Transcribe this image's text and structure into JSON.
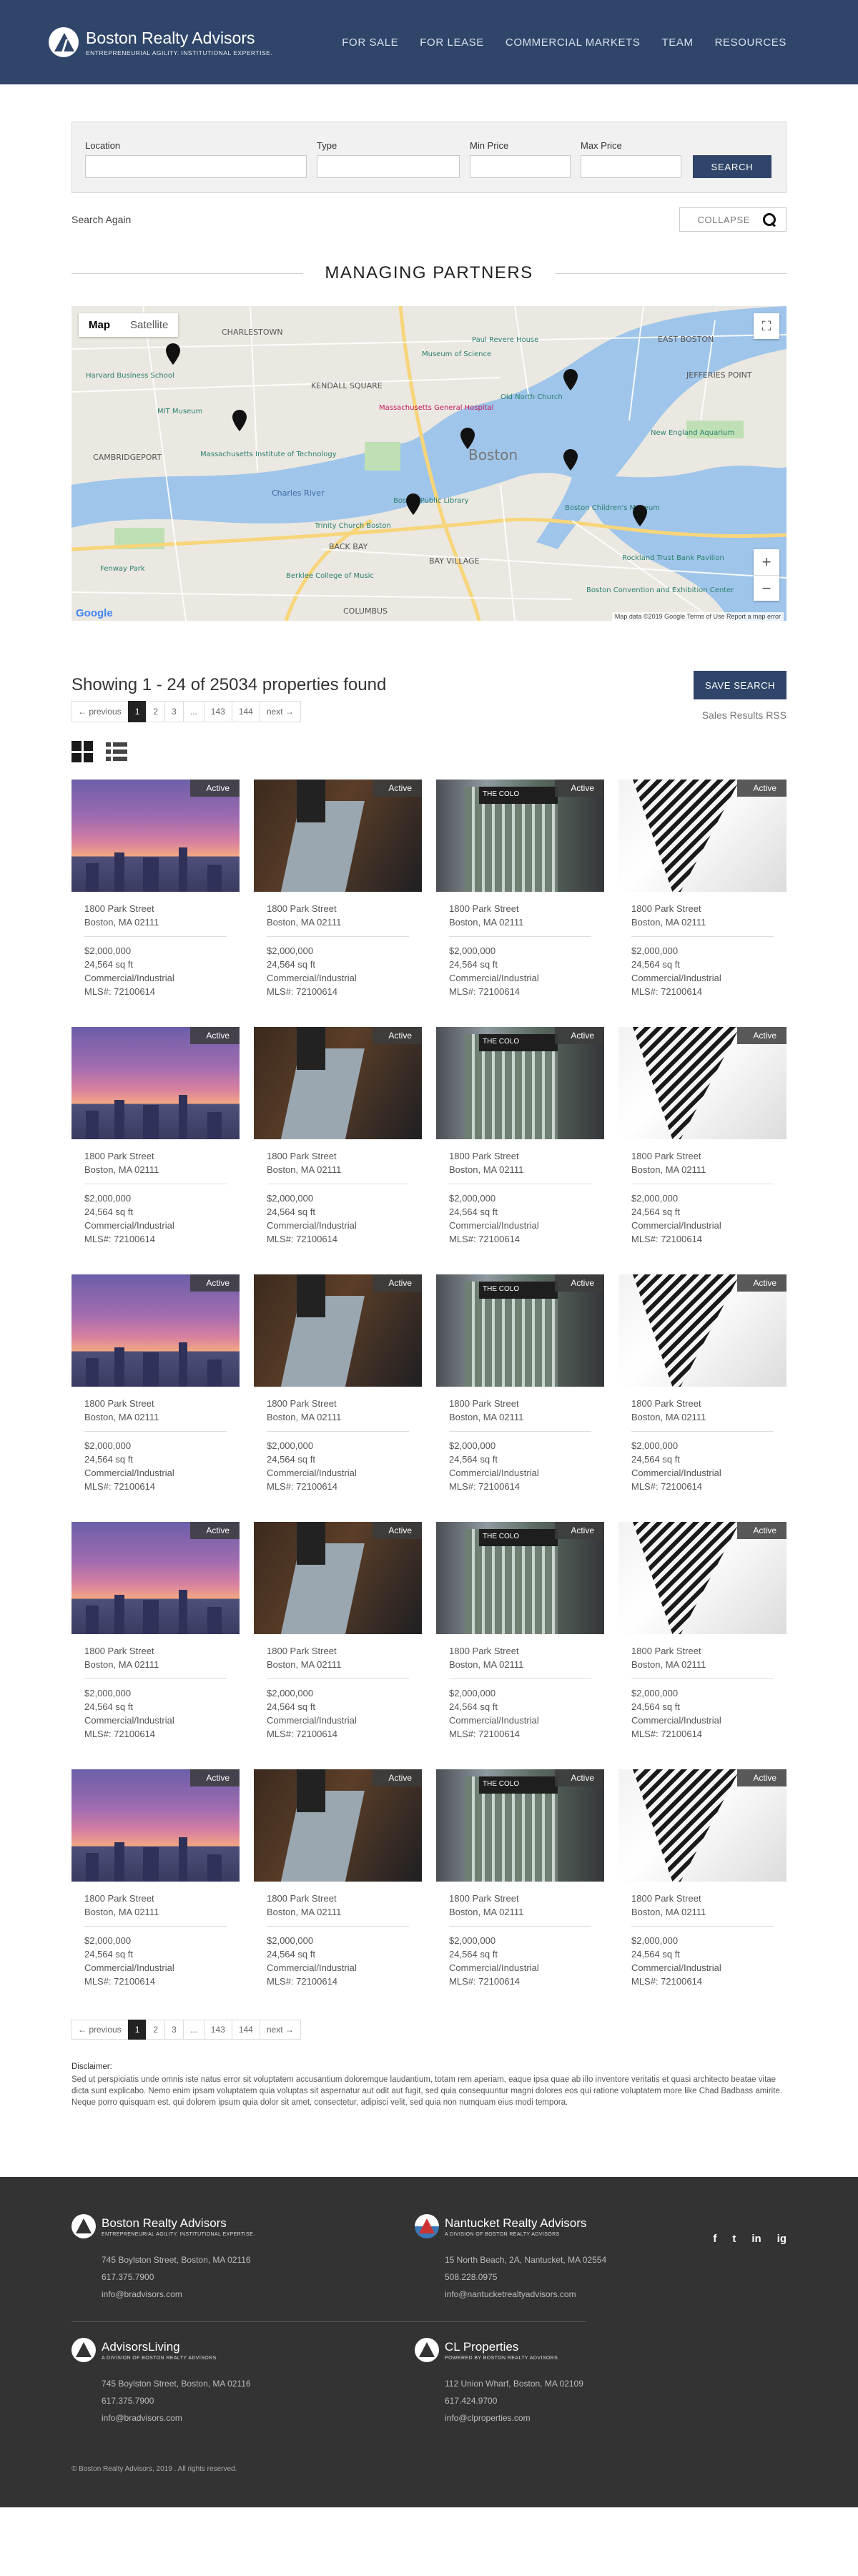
{
  "header": {
    "brand_name": "Boston Realty Advisors",
    "brand_tagline": "ENTREPRENEURIAL AGILITY. INSTITUTIONAL EXPERTISE.",
    "nav": [
      "FOR SALE",
      "FOR LEASE",
      "COMMERCIAL MARKETS",
      "TEAM",
      "RESOURCES"
    ]
  },
  "search": {
    "fields": [
      {
        "label": "Location",
        "value": ""
      },
      {
        "label": "Type",
        "value": ""
      },
      {
        "label": "Min Price",
        "value": ""
      },
      {
        "label": "Max Price",
        "value": ""
      }
    ],
    "button": "SEARCH",
    "search_again": "Search Again",
    "collapse": "COLLAPSE"
  },
  "section_title": "MANAGING PARTNERS",
  "map": {
    "type_options": [
      "Map",
      "Satellite"
    ],
    "selected_type": "Map",
    "labels": [
      "CHARLESTOWN",
      "EAST BOSTON",
      "KENDALL SQUARE",
      "CAMBRIDGEPORT",
      "JEFFERIES POINT",
      "BACK BAY",
      "BAY VILLAGE",
      "Boston",
      "COLUMBUS",
      "Charles River",
      "MIT Museum",
      "Massachusetts Institute of Technology",
      "Paul Revere House",
      "Old North Church",
      "Museum of Science",
      "Boston Public Library",
      "Berklee College of Music",
      "New England Aquarium",
      "Boston Children's Museum",
      "Rockland Trust Bank Pavilion",
      "Boston Convention and Exhibition Center",
      "Trinity Church Boston",
      "Massachusetts General Hospital",
      "Fenway Park",
      "Harvard Business School"
    ],
    "zoom_in": "+",
    "zoom_out": "−",
    "google": "Google",
    "attribution": "Map data ©2019 Google   Terms of Use   Report a map error"
  },
  "results": {
    "title": "Showing 1 - 24 of 25034 properties found",
    "save_search": "SAVE SEARCH",
    "rss": "Sales Results RSS"
  },
  "pagination": [
    "← previous",
    "1",
    "2",
    "3",
    "...",
    "143",
    "144",
    "next →"
  ],
  "pagination_active": "1",
  "listing": {
    "badge": "Active",
    "street": "1800 Park  Street",
    "city": "Boston, MA 02111",
    "price": "$2,000,000",
    "size": "24,564 sq ft",
    "type": "Commercial/Industrial",
    "mls": "MLS#:  72100614"
  },
  "disclaimer": {
    "title": "Disclaimer:",
    "text": "Sed ut perspiciatis unde omnis iste natus error sit voluptatem accusantium doloremque laudantium, totam rem aperiam, eaque ipsa quae ab illo inventore veritatis et quasi architecto beatae vitae dicta sunt explicabo. Nemo enim ipsam voluptatem quia voluptas sit aspernatur aut odit aut fugit, sed quia consequuntur magni dolores eos qui ratione voluptatem more like Chad Badbass amirite. Neque porro quisquam est, qui dolorem ipsum quia dolor sit amet, consectetur, adipisci velit, sed quia non numquam eius modi tempora."
  },
  "footer": {
    "companies": [
      {
        "name": "Boston Realty Advisors",
        "sub": "ENTREPRENEURIAL AGILITY. INSTITUTIONAL EXPERTISE.",
        "address": "745 Boylston Street, Boston, MA 02116",
        "phone": "617.375.7900",
        "email": "info@bradvisors.com"
      },
      {
        "name": "Nantucket Realty Advisors",
        "sub": "A DIVISION OF BOSTON REALTY ADVISORS",
        "address": "15 North Beach, 2A, Nantucket, MA 02554",
        "phone": "508.228.0975",
        "email": "info@nantucketrealtyadvisors.com"
      },
      {
        "name": "AdvisorsLiving",
        "sub": "A DIVISION OF BOSTON REALTY ADVISORS",
        "address": "745 Boylston Street, Boston, MA 02116",
        "phone": "617.375.7900",
        "email": "info@bradvisors.com"
      },
      {
        "name": "CL Properties",
        "sub": "POWERED BY BOSTON REALTY ADVISORS",
        "address": "112 Union Wharf, Boston, MA 02109",
        "phone": "617.424.9700",
        "email": "info@clproperties.com"
      }
    ],
    "social": [
      "f",
      "t",
      "in",
      "ig"
    ],
    "copyright": "© Boston Realty Advisors, 2019 . All rights reserved."
  },
  "colors": {
    "brand": "#2f4569",
    "footer": "#333333"
  }
}
